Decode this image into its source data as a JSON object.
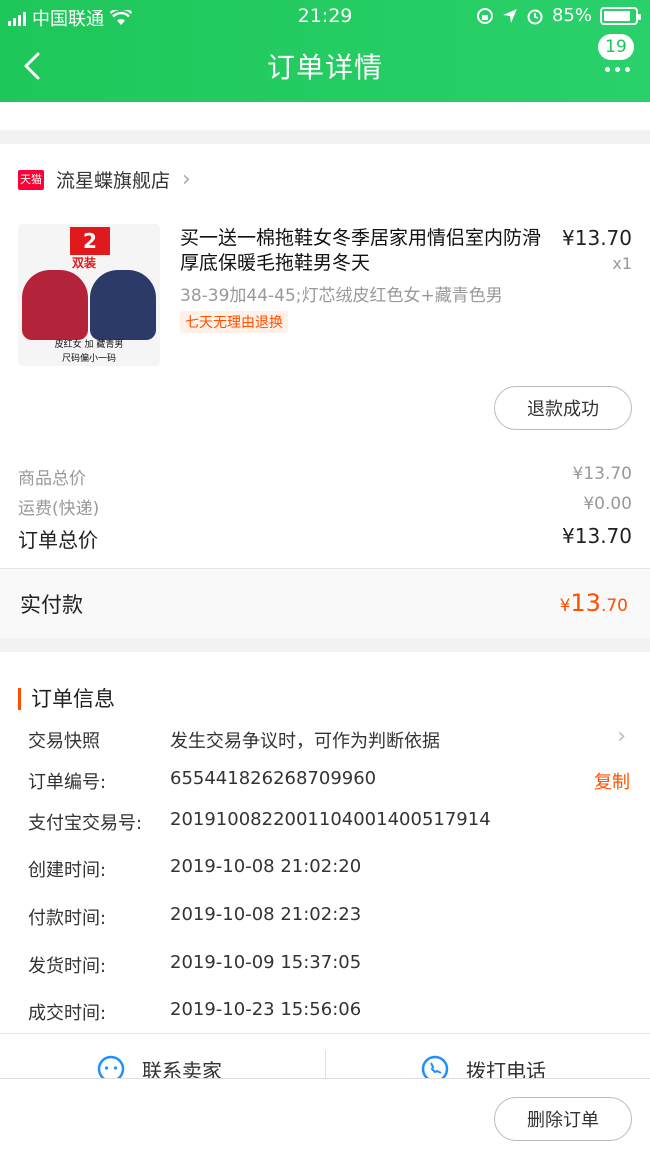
{
  "status_bar": {
    "carrier": "中国联通",
    "time": "21:29",
    "battery": "85%",
    "battery_level": 0.85
  },
  "nav": {
    "title": "订单详情",
    "badge_count": "19"
  },
  "shop": {
    "name": "流星蝶旗舰店",
    "platform_icon_text": "天猫"
  },
  "product": {
    "title": "买一送一棉拖鞋女冬季居家用情侣室内防滑厚底保暖毛拖鞋男冬天",
    "price": "¥13.70",
    "qty": "x1",
    "sku": "38-39加44-45;灯芯绒皮红色女+藏青色男",
    "tag": "七天无理由退换",
    "thumb_badge": "2",
    "thumb_badge2": "双装",
    "thumb_caption_1": "皮红女   加   藏青男",
    "thumb_caption_2": "尺码偏小一码",
    "refund_status": "退款成功"
  },
  "fees": {
    "goods_label": "商品总价",
    "goods_value": "¥13.70",
    "shipping_label": "运费(快递)",
    "shipping_value": "¥0.00",
    "total_label": "订单总价",
    "total_value": "¥13.70"
  },
  "paid": {
    "label": "实付款",
    "currency": "¥",
    "amount_major": "13",
    "amount_minor": ".70"
  },
  "order_info": {
    "title": "订单信息",
    "snapshot_label": "交易快照",
    "snapshot_value": "发生交易争议时，可作为判断依据",
    "order_no_label": "订单编号:",
    "order_no": "655441826268709960",
    "copy_label": "复制",
    "alipay_label": "支付宝交易号:",
    "alipay_no": "2019100822001104001400517914",
    "created_label": "创建时间:",
    "created": "2019-10-08 21:02:20",
    "paid_label": "付款时间:",
    "paid_time": "2019-10-08 21:02:23",
    "shipped_label": "发货时间:",
    "shipped": "2019-10-09 15:37:05",
    "completed_label": "成交时间:",
    "completed": "2019-10-23 15:56:06"
  },
  "actions": {
    "contact_seller": "联系卖家",
    "call_phone": "拨打电话"
  },
  "bottom": {
    "delete_order": "删除订单"
  },
  "colors": {
    "primary": "#1fc75a",
    "accent": "#ff5000"
  }
}
